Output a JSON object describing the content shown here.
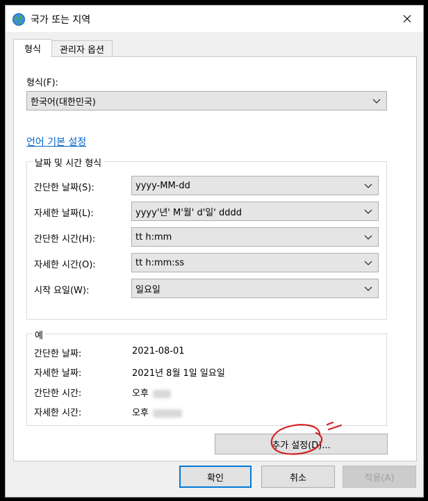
{
  "window": {
    "title": "국가 또는 지역"
  },
  "tabs": [
    {
      "label": "형식",
      "active": true
    },
    {
      "label": "관리자 옵션",
      "active": false
    }
  ],
  "format": {
    "label": "형식(F):",
    "value": "한국어(대한민국)"
  },
  "language_link": "언어 기본 설정",
  "datetime_group": {
    "title": "날짜 및 시간 형식",
    "rows": [
      {
        "label": "간단한 날짜(S):",
        "value": "yyyy-MM-dd"
      },
      {
        "label": "자세한 날짜(L):",
        "value": "yyyy'년' M'월' d'일' dddd"
      },
      {
        "label": "간단한 시간(H):",
        "value": "tt h:mm"
      },
      {
        "label": "자세한 시간(O):",
        "value": "tt h:mm:ss"
      },
      {
        "label": "시작 요일(W):",
        "value": "일요일"
      }
    ]
  },
  "example_group": {
    "title": "예",
    "rows": [
      {
        "label": "간단한 날짜:",
        "value": "2021-08-01"
      },
      {
        "label": "자세한 날짜:",
        "value": "2021년 8월 1일 일요일"
      },
      {
        "label": "간단한 시간:",
        "value": "오후"
      },
      {
        "label": "자세한 시간:",
        "value": "오후"
      }
    ]
  },
  "additional_settings": "추가 설정(D)...",
  "buttons": {
    "ok": "확인",
    "cancel": "취소",
    "apply": "적용(A)"
  },
  "colors": {
    "accent": "#0078d7",
    "link": "#0066cc",
    "annotation": "#d42020"
  }
}
